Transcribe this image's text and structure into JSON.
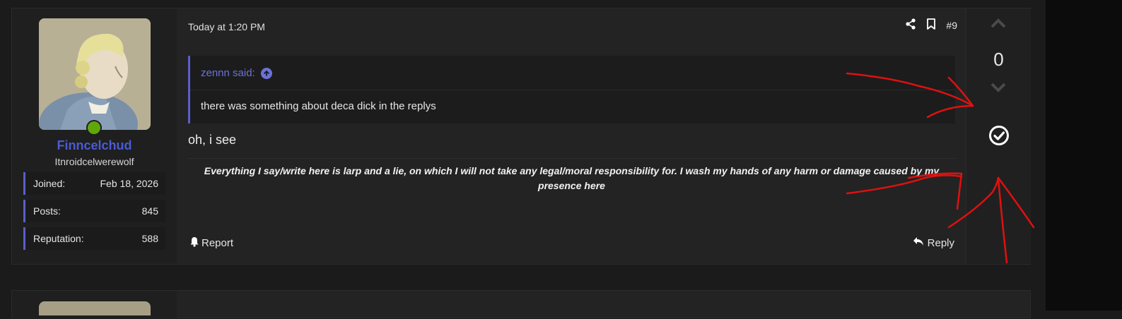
{
  "post": {
    "date": "Today at 1:20 PM",
    "post_number": "#9",
    "quote": {
      "author": "zennn said:",
      "text": "there was something about deca dick in the replys"
    },
    "message": "oh, i see",
    "signature": "Everything I say/write here is larp and a lie, on which I will not take any legal/moral responsibility for. I wash my hands of any harm or damage caused by my presence here",
    "report_label": "Report",
    "reply_label": "Reply"
  },
  "user": {
    "name": "Finncelchud",
    "title": "Itnroidcelwerewolf",
    "stats": [
      {
        "label": "Joined:",
        "value": "Feb 18, 2026"
      },
      {
        "label": "Posts:",
        "value": "845"
      },
      {
        "label": "Reputation:",
        "value": "588"
      }
    ],
    "online": true
  },
  "vote": {
    "count": "0"
  },
  "icons": {
    "share": "share-icon",
    "bookmark": "bookmark-icon",
    "quote_up": "arrow-up-circle-icon",
    "upvote": "chevron-up-icon",
    "downvote": "chevron-down-icon",
    "accept": "check-circle-icon",
    "report": "bell-icon",
    "reply": "reply-icon"
  },
  "colors": {
    "accent": "#5a5fc7",
    "username": "#4b5bd4",
    "online": "#5fa70b",
    "annotation": "#e01010"
  }
}
